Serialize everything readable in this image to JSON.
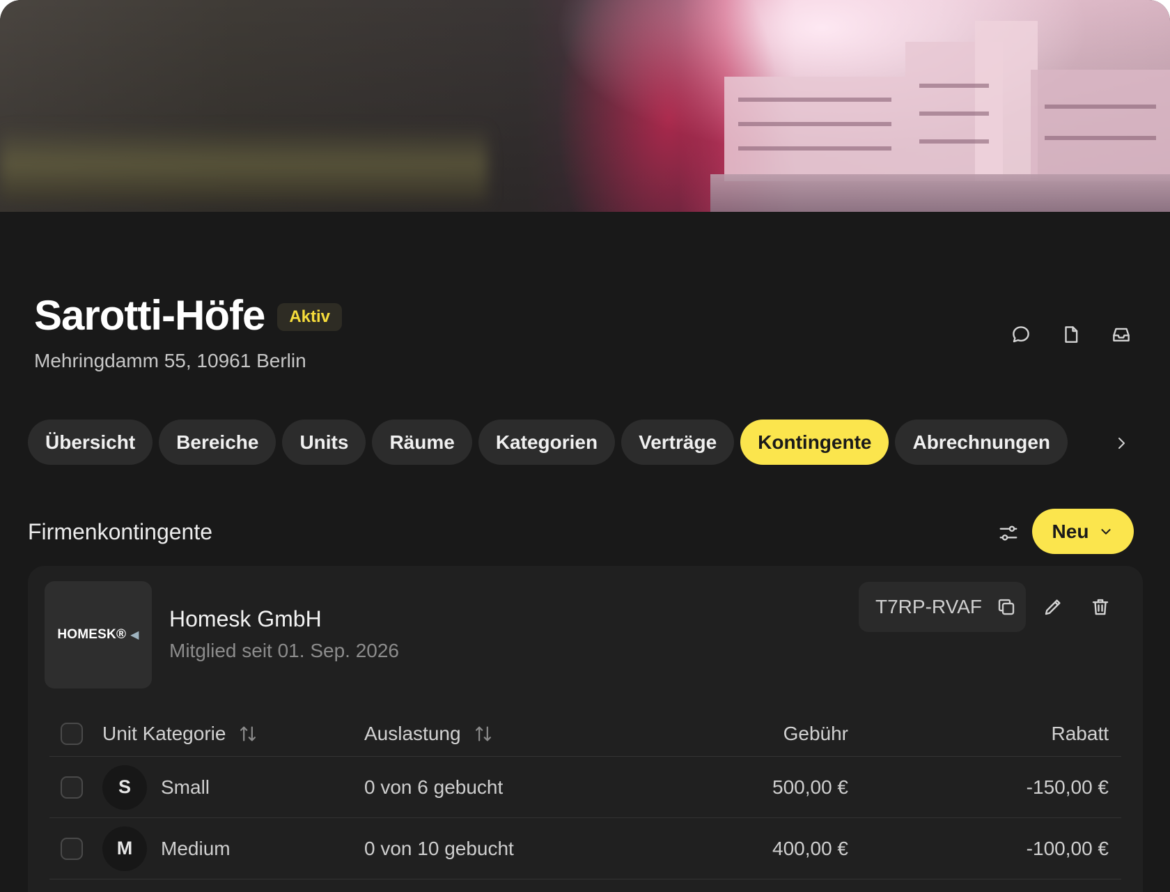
{
  "header": {
    "title": "Sarotti-Höfe",
    "status": "Aktiv",
    "address": "Mehringdamm 55, 10961 Berlin",
    "actions": [
      "chat-icon",
      "document-icon",
      "inbox-icon"
    ]
  },
  "tabs": [
    {
      "label": "Übersicht",
      "active": false
    },
    {
      "label": "Bereiche",
      "active": false
    },
    {
      "label": "Units",
      "active": false
    },
    {
      "label": "Räume",
      "active": false
    },
    {
      "label": "Kategorien",
      "active": false
    },
    {
      "label": "Verträge",
      "active": false
    },
    {
      "label": "Kontingente",
      "active": true
    },
    {
      "label": "Abrechnungen",
      "active": false
    }
  ],
  "section": {
    "title": "Firmenkontingente",
    "new_label": "Neu"
  },
  "company": {
    "logo_text": "HOMESK®",
    "name": "Homesk GmbH",
    "member_since": "Mitglied seit 01. Sep. 2026",
    "code": "T7RP-RVAF"
  },
  "table": {
    "columns": {
      "category": "Unit Kategorie",
      "utilization": "Auslastung",
      "fee": "Gebühr",
      "discount": "Rabatt"
    },
    "rows": [
      {
        "initial": "S",
        "category": "Small",
        "utilization": "0 von 6 gebucht",
        "fee": "500,00 €",
        "discount": "-150,00 €"
      },
      {
        "initial": "M",
        "category": "Medium",
        "utilization": "0 von 10 gebucht",
        "fee": "400,00 €",
        "discount": "-100,00 €"
      }
    ]
  },
  "colors": {
    "accent": "#fbe54d",
    "background": "#191919",
    "card": "#202020",
    "badge_text": "#f7dd3b"
  }
}
